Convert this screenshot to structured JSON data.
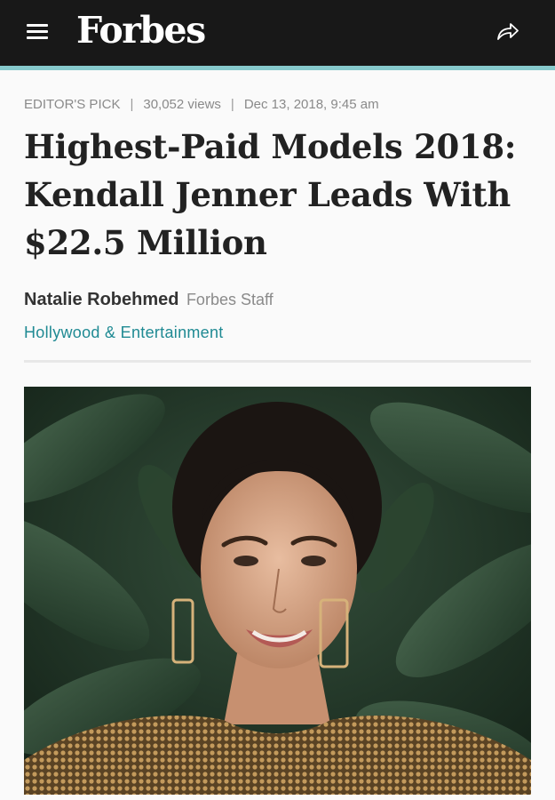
{
  "header": {
    "logo": "Forbes",
    "menu_icon": "hamburger-menu-icon",
    "share_icon": "share-arrow-icon",
    "background_color": "#181818",
    "accent_color": "#86c9cc"
  },
  "article": {
    "meta": {
      "label": "EDITOR'S PICK",
      "views": "30,052 views",
      "date": "Dec 13, 2018, 9:45 am"
    },
    "headline": {
      "line1": "Highest-Paid Models 2018:",
      "line2": "Kendall Jenner Leads With",
      "line3": "$22.5 Million"
    },
    "author": {
      "name": "Natalie Robehmed",
      "role": "Forbes Staff"
    },
    "channel": "Hollywood & Entertainment",
    "channel_color": "#1f8a93",
    "hero_image": {
      "subject": "smiling woman with dark hair pulled back, hoop earrings and metallic top in front of green leaves"
    }
  }
}
